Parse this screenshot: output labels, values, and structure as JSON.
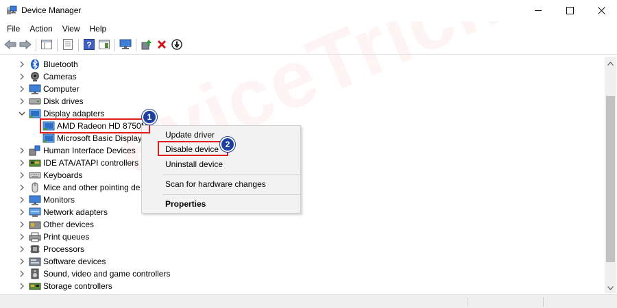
{
  "window": {
    "title": "Device Manager",
    "minimize_icon": "minimize-icon",
    "maximize_icon": "maximize-icon",
    "close_icon": "close-icon"
  },
  "menu": [
    "File",
    "Action",
    "View",
    "Help"
  ],
  "toolbar": {
    "icons": [
      "back-arrow-icon",
      "forward-arrow-icon",
      "console-tree-icon",
      "properties-sheet-icon",
      "help-icon",
      "show-hide-icon",
      "monitor-scan-icon",
      "update-driver-icon",
      "uninstall-x-icon",
      "disable-device-icon"
    ]
  },
  "tree": {
    "rows": [
      {
        "label": "Bluetooth",
        "icon": "bluetooth-icon",
        "expanded": false
      },
      {
        "label": "Cameras",
        "icon": "camera-icon",
        "expanded": false
      },
      {
        "label": "Computer",
        "icon": "computer-icon",
        "expanded": false
      },
      {
        "label": "Disk drives",
        "icon": "disk-drive-icon",
        "expanded": false
      },
      {
        "label": "Display adapters",
        "icon": "display-adapter-icon",
        "expanded": true
      },
      {
        "label": "AMD Radeon HD 8750M",
        "icon": "display-adapter-icon",
        "child": true
      },
      {
        "label": "Microsoft Basic Display",
        "icon": "display-adapter-icon",
        "child": true
      },
      {
        "label": "Human Interface Devices",
        "icon": "hid-icon",
        "expanded": false
      },
      {
        "label": "IDE ATA/ATAPI controllers",
        "icon": "ide-controller-icon",
        "expanded": false
      },
      {
        "label": "Keyboards",
        "icon": "keyboard-icon",
        "expanded": false
      },
      {
        "label": "Mice and other pointing de",
        "icon": "mouse-icon",
        "expanded": false
      },
      {
        "label": "Monitors",
        "icon": "monitor-icon",
        "expanded": false
      },
      {
        "label": "Network adapters",
        "icon": "network-adapter-icon",
        "expanded": false
      },
      {
        "label": "Other devices",
        "icon": "other-devices-icon",
        "expanded": false
      },
      {
        "label": "Print queues",
        "icon": "printer-icon",
        "expanded": false
      },
      {
        "label": "Processors",
        "icon": "processor-icon",
        "expanded": false
      },
      {
        "label": "Software devices",
        "icon": "software-device-icon",
        "expanded": false
      },
      {
        "label": "Sound, video and game controllers",
        "icon": "speaker-icon",
        "expanded": false
      },
      {
        "label": "Storage controllers",
        "icon": "storage-controller-icon",
        "expanded": false
      }
    ]
  },
  "context_menu": {
    "items": [
      {
        "label": "Update driver",
        "bold": false
      },
      {
        "label": "Disable device",
        "bold": false
      },
      {
        "label": "Uninstall device",
        "bold": false
      },
      {
        "label": "Scan for hardware changes",
        "bold": false
      },
      {
        "label": "Properties",
        "bold": true
      }
    ]
  },
  "annotations": {
    "badge_1": "1",
    "badge_2": "2",
    "highlight_color": "#e21b1b",
    "badge_color": "#1d3f9f"
  },
  "watermark": "eviceTricks"
}
